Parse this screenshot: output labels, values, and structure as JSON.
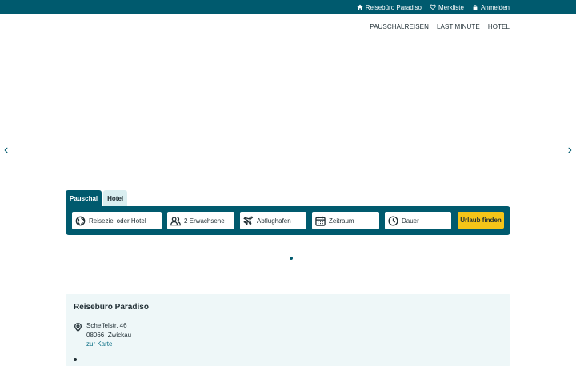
{
  "topbar": {
    "agency_label": "Reisebüro Paradiso",
    "wishlist_label": "Merkliste",
    "login_label": "Anmelden"
  },
  "nav": {
    "items": [
      {
        "label": "PAUSCHALREISEN"
      },
      {
        "label": "LAST MINUTE"
      },
      {
        "label": "HOTEL"
      }
    ]
  },
  "hero": {
    "prev_icon": "chevron-left-icon",
    "next_icon": "chevron-right-icon",
    "prev_glyph": "‹",
    "next_glyph": "›"
  },
  "search": {
    "tabs": [
      {
        "label": "Pauschal",
        "active": true
      },
      {
        "label": "Hotel",
        "active": false
      }
    ],
    "destination": "Reiseziel oder Hotel",
    "travelers": "2 Erwachsene",
    "airport": "Abflughafen",
    "period": "Zeitraum",
    "duration": "Dauer",
    "submit_label": "Urlaub finden"
  },
  "agency": {
    "title": "Reisebüro Paradiso",
    "street": "Scheffelstr. 46",
    "city": "08066  Zwickau",
    "map_link": "zur Karte"
  },
  "colors": {
    "primary": "#005a6e",
    "accent": "#f5c518",
    "tab_inactive": "#d9eef0",
    "card_bg": "#eef7f8"
  }
}
